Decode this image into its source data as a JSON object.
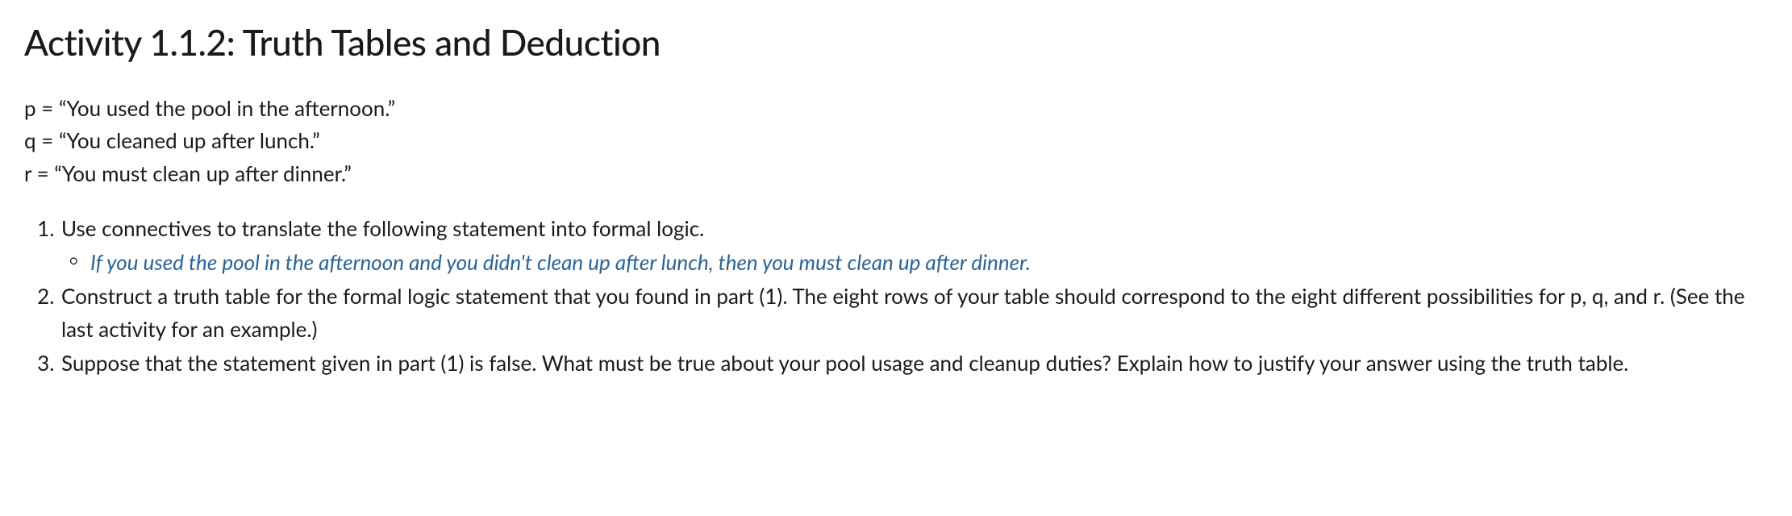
{
  "title": "Activity 1.1.2: Truth Tables and Deduction",
  "propositions": {
    "p": "p = “You used the pool in the afternoon.”",
    "q": "q = “You cleaned up after lunch.”",
    "r": "r = “You must clean up after dinner.”"
  },
  "questions": {
    "item1": {
      "text": "Use connectives to translate the following statement into formal logic.",
      "sub": "If you used the pool in the afternoon and you didn't clean up after lunch, then you must clean up after dinner."
    },
    "item2": {
      "text": "Construct a truth table for the formal logic statement that you found in part (1). The eight rows of your table should correspond to the eight different possibilities for p, q, and r. (See the last activity for an example.)"
    },
    "item3": {
      "text": "Suppose that the statement given in part (1) is false. What must be true about your pool usage and cleanup duties? Explain how to justify your answer using the truth table."
    }
  }
}
